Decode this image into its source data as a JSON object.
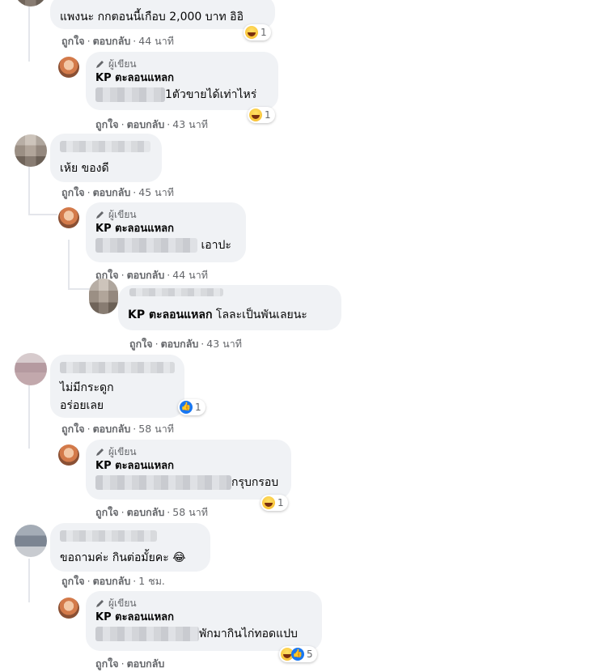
{
  "actions": {
    "like": "ถูกใจ",
    "reply": "ตอบกลับ",
    "sep": "·"
  },
  "author_badge": "ผู้เขียน",
  "comments": [
    {
      "text": "แพงนะ กกตอนนี้เกือบ 2,000 บาท อิอิ",
      "time": "44 นาที",
      "reactions": {
        "count": "1",
        "icons": [
          "haha-icon"
        ]
      }
    },
    {
      "name": "KP ตะลอนแหลก",
      "text": "1ตัวขายได้เท่าไหร่",
      "time": "43 นาที",
      "reactions": {
        "count": "1",
        "icons": [
          "haha-icon"
        ]
      }
    },
    {
      "text": "เห้ย ของดี",
      "time": "45 นาที"
    },
    {
      "name": "KP ตะลอนแหลก",
      "text": "เอาปะ",
      "time": "44 นาที"
    },
    {
      "mention": "KP ตะลอนแหลก",
      "text": "โลละเป็นพันเลยนะ",
      "time": "43 นาที"
    },
    {
      "text_line1": "ไม่มีกระดูก",
      "text_line2": "อร่อยเลย",
      "time": "58 นาที",
      "reactions": {
        "count": "1",
        "icons": [
          "like-icon"
        ]
      }
    },
    {
      "name": "KP ตะลอนแหลก",
      "text": "กรุบกรอบ",
      "time": "58 นาที",
      "reactions": {
        "count": "1",
        "icons": [
          "haha-icon"
        ]
      }
    },
    {
      "text": "ขอถามค่ะ กินต่อมั้ยคะ 😂",
      "time": "1 ชม."
    },
    {
      "name": "KP ตะลอนแหลก",
      "text": "พักมากินไก่ทอดแปบ",
      "reactions": {
        "count": "5",
        "icons": [
          "haha-icon",
          "like-icon"
        ]
      }
    }
  ],
  "colors": {
    "bubble": "#f0f2f5",
    "meta": "#65676b",
    "like_blue": "#1877f2",
    "haha_yellow": "#f7b928"
  }
}
